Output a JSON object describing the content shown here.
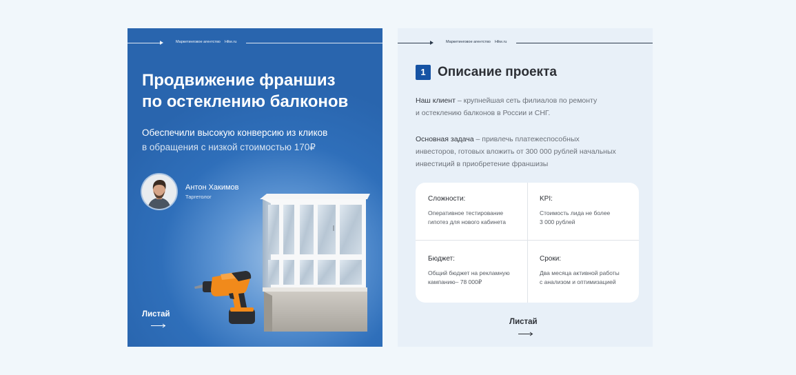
{
  "left_slide": {
    "header": {
      "agency": "Маркетинговое агентство",
      "site": "Hike.ru"
    },
    "title_line1": "Продвижение франшиз",
    "title_line2": "по остеклению балконов",
    "subtitle_line1": "Обеспечили высокую конверсию из кликов",
    "subtitle_line2": "в обращения с низкой стоимостью 170₽",
    "author": {
      "name": "Антон Хакимов",
      "role": "Таргетолог"
    },
    "swipe_label": "Листай"
  },
  "right_slide": {
    "header": {
      "agency": "Маркетинговое агентство",
      "site": "Hike.ru"
    },
    "section_number": "1",
    "section_title": "Описание проекта",
    "paragraph1": {
      "lead": "Наш клиент",
      "line1": " – крупнейшая сеть филиалов по ремонту",
      "line2": "и остеклению балконов в России и СНГ."
    },
    "paragraph2": {
      "lead": "Основная задача",
      "line1": " – привлечь платежеспособных",
      "line2": "инвесторов, готовых вложить от 300 000 рублей начальных",
      "line3": "инвестиций в приобретение франшизы"
    },
    "grid": [
      {
        "label": "Сложности:",
        "line1": "Оперативное тестирование",
        "line2": "гипотез для нового кабинета"
      },
      {
        "label": "KPI:",
        "line1": "Стоимость лида не более",
        "line2": "3 000 рублей"
      },
      {
        "label": "Бюджет:",
        "line1": "Общий бюджет на рекламную",
        "line2": "кампанию– 78 000₽"
      },
      {
        "label": "Сроки:",
        "line1": "Два месяца активной работы",
        "line2": "с анализом и оптимизацией"
      }
    ],
    "swipe_label": "Листай"
  },
  "colors": {
    "left_bg": "#2965ae",
    "badge": "#1653a4",
    "right_bg": "#e8f0f8",
    "drill_orange": "#f18a1b"
  },
  "icons": {
    "header_arrow": "arrow-right-icon",
    "swipe_arrow": "long-arrow-right-icon",
    "illustration_1": "balcony-window-illustration",
    "illustration_2": "cordless-drill-illustration"
  }
}
